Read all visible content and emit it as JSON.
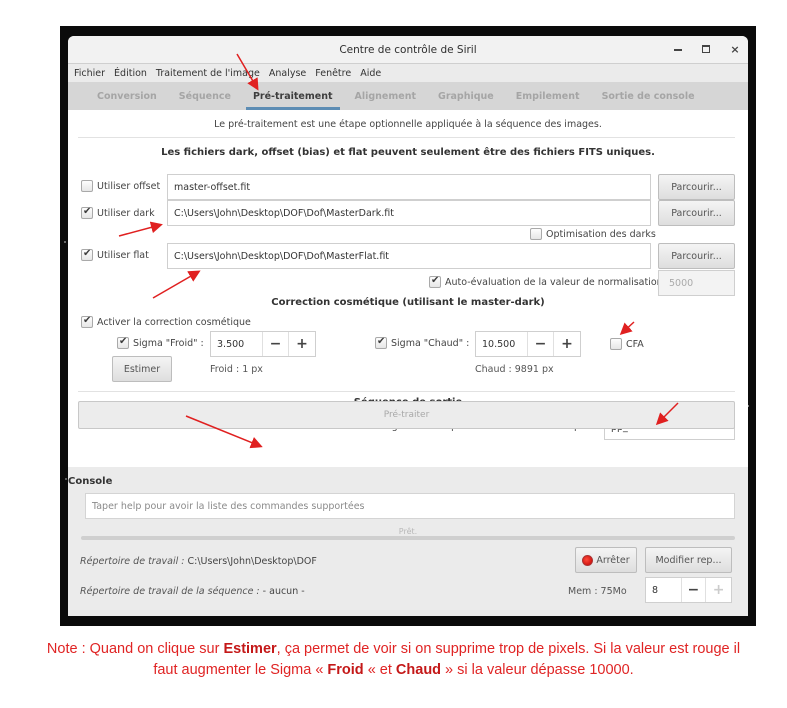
{
  "window": {
    "title": "Centre de contrôle de Siril",
    "controls": {
      "minimize": "minimize",
      "maximize": "maximize",
      "close": "×"
    }
  },
  "menubar": [
    "Fichier",
    "Édition",
    "Traitement de l'image",
    "Analyse",
    "Fenêtre",
    "Aide"
  ],
  "tabs": [
    {
      "label": "Conversion",
      "active": false
    },
    {
      "label": "Séquence",
      "active": false
    },
    {
      "label": "Pré-traitement",
      "active": true
    },
    {
      "label": "Alignement",
      "active": false
    },
    {
      "label": "Graphique",
      "active": false
    },
    {
      "label": "Empilement",
      "active": false
    },
    {
      "label": "Sortie de console",
      "active": false
    }
  ],
  "preprocessing": {
    "intro": "Le pré-traitement est une étape optionnelle appliquée à la séquence des images.",
    "notice": "Les fichiers dark, offset (bias) et flat peuvent seulement être des fichiers FITS uniques.",
    "offset": {
      "label": "Utiliser offset",
      "checked": false,
      "value": "master-offset.fit",
      "browse": "Parcourir..."
    },
    "dark": {
      "label": "Utiliser dark",
      "checked": true,
      "value": "C:\\Users\\John\\Desktop\\DOF\\Dof\\MasterDark.fit",
      "browse": "Parcourir..."
    },
    "dark_optimisation": {
      "label": "Optimisation des darks",
      "checked": false
    },
    "flat": {
      "label": "Utiliser flat",
      "checked": true,
      "value": "C:\\Users\\John\\Desktop\\DOF\\Dof\\MasterFlat.fit",
      "browse": "Parcourir..."
    },
    "auto_normalisation": {
      "label": "Auto-évaluation de la valeur de normalisation",
      "checked": true,
      "value": "5000"
    },
    "cosmetic": {
      "title": "Correction cosmétique (utilisant le master-dark)",
      "enable_label": "Activer la correction cosmétique",
      "enable_checked": true,
      "sigma_cold": {
        "label": "Sigma \"Froid\" :",
        "checked": true,
        "value": "3.500",
        "result": "Froid : 1 px"
      },
      "sigma_hot": {
        "label": "Sigma \"Chaud\" :",
        "checked": true,
        "value": "10.500",
        "result": "Chaud : 9891 px"
      },
      "cfa": {
        "label": "CFA",
        "checked": false
      },
      "estimate_button": "Estimer",
      "minus": "−",
      "plus": "+"
    },
    "output": {
      "title": "Séquence de sortie",
      "prefix_label": "Enregistrer la séquence résultante avec le préfixe :",
      "prefix_value": "pp_",
      "run_button": "Pré-traiter"
    }
  },
  "console": {
    "label": "Console",
    "placeholder": "Taper help pour avoir la liste des commandes supportées",
    "status": "Prêt."
  },
  "footer": {
    "working_dir_label": "Répertoire de travail :",
    "working_dir_value": "C:\\Users\\John\\Desktop\\DOF",
    "seq_dir_label": "Répertoire de travail de la séquence :",
    "seq_dir_value": "- aucun -",
    "stop_button": "Arrêter",
    "change_dir_button": "Modifier rep...",
    "memory": "Mem : 75Mo",
    "threads_value": "8",
    "minus": "−",
    "plus": "+"
  },
  "annotation": {
    "note_prefix": "Note : Quand on clique sur ",
    "note_bold1": "Estimer",
    "note_mid1": ", ça permet de voir si on supprime trop de pixels. Si la valeur est rouge il faut augmenter le Sigma « ",
    "note_bold2": "Froid",
    "note_mid2": " « et ",
    "note_bold3": "Chaud",
    "note_suffix": " » si la valeur dépasse 10000.",
    "arrow_color": "#e02020"
  },
  "colors": {
    "tab_accent": "#5d8db4",
    "note_red": "#e02424"
  }
}
